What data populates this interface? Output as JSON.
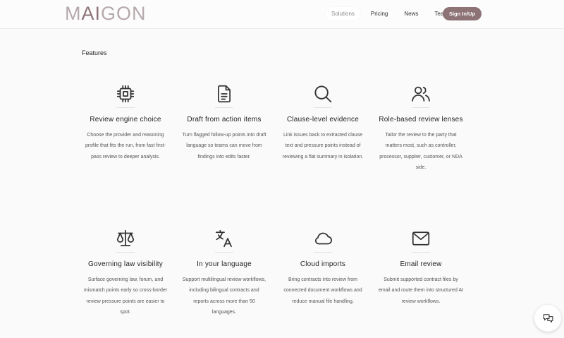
{
  "brand": {
    "logo_prefix": "M",
    "logo_accent": "AI",
    "logo_suffix": "GON"
  },
  "nav": {
    "items": [
      {
        "label": "Solutions",
        "active": true
      },
      {
        "label": "Pricing"
      },
      {
        "label": "News"
      },
      {
        "label": "Team"
      }
    ],
    "signin_label": "Sign In/Up"
  },
  "features": {
    "heading": "Features",
    "cards": [
      {
        "icon": "cpu-chip-icon",
        "title": "Review engine choice",
        "description": "Choose the provider and reasoning profile that fits the run, from fast first-pass review to deeper analysis."
      },
      {
        "icon": "document-icon",
        "title": "Draft from action items",
        "description": "Turn flagged follow-up points into draft language so teams can move from findings into edits faster."
      },
      {
        "icon": "search-icon",
        "title": "Clause-level evidence",
        "description": "Link issues back to extracted clause text and pressure points instead of reviewing a flat summary in isolation."
      },
      {
        "icon": "users-icon",
        "title": "Role-based review lenses",
        "description": "Tailor the review to the party that matters most, such as controller, processor, supplier, customer, or NDA side."
      },
      {
        "icon": "scale-icon",
        "title": "Governing law visibility",
        "description": "Surface governing law, forum, and mismatch points early so cross-border review pressure points are easier to spot."
      },
      {
        "icon": "translate-icon",
        "title": "In your language",
        "description": "Support multilingual review workflows, including bilingual contracts and reports across more than 50 languages."
      },
      {
        "icon": "cloud-icon",
        "title": "Cloud imports",
        "description": "Bring contracts into review from connected document workflows and reduce manual file handling."
      },
      {
        "icon": "envelope-icon",
        "title": "Email review",
        "description": "Submit supported contract files by email and route them into structured AI review workflows."
      }
    ]
  },
  "colors": {
    "accent": "#8d7276",
    "logo_light": "#b6a9ac",
    "background": "#fafafa"
  }
}
